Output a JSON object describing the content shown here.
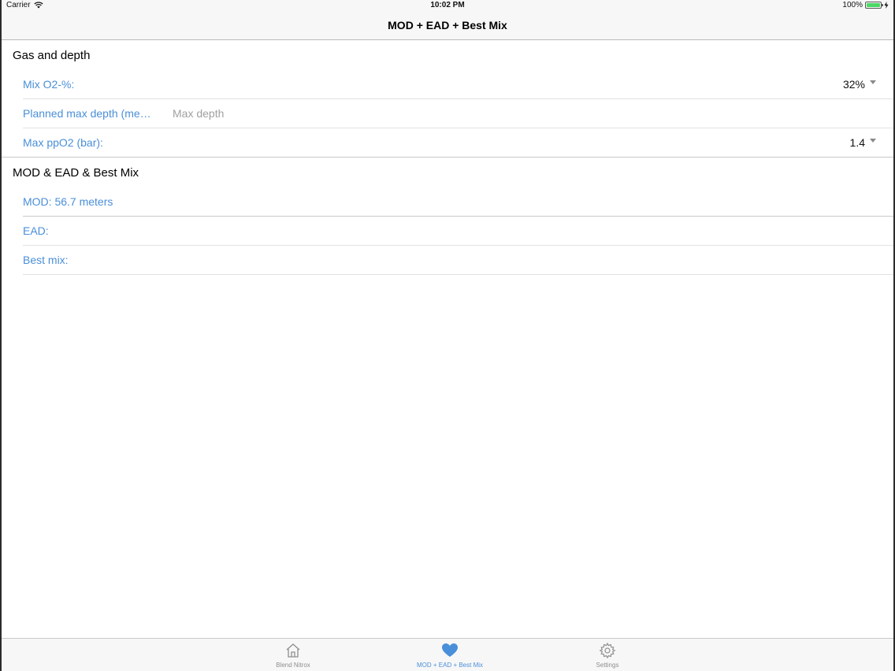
{
  "status_bar": {
    "carrier": "Carrier",
    "time": "10:02 PM",
    "battery": "100%"
  },
  "nav": {
    "title": "MOD + EAD + Best Mix"
  },
  "sections": {
    "gas": {
      "title": "Gas and depth",
      "mix_label": "Mix O2-%:",
      "mix_value": "32%",
      "depth_label": "Planned max depth (meters):",
      "depth_placeholder": "Max depth",
      "ppo2_label": "Max ppO2 (bar):",
      "ppo2_value": "1.4"
    },
    "results": {
      "title": "MOD & EAD & Best Mix",
      "mod": "MOD: 56.7 meters",
      "ead": "EAD:",
      "best_mix": "Best mix:"
    }
  },
  "tabs": [
    {
      "label": "Blend Nitrox",
      "icon": "home-icon",
      "active": false
    },
    {
      "label": "MOD + EAD + Best Mix",
      "icon": "heart-icon",
      "active": true
    },
    {
      "label": "Settings",
      "icon": "gear-icon",
      "active": false
    }
  ],
  "colors": {
    "accent": "#4a8fd9",
    "battery": "#4cd964"
  }
}
